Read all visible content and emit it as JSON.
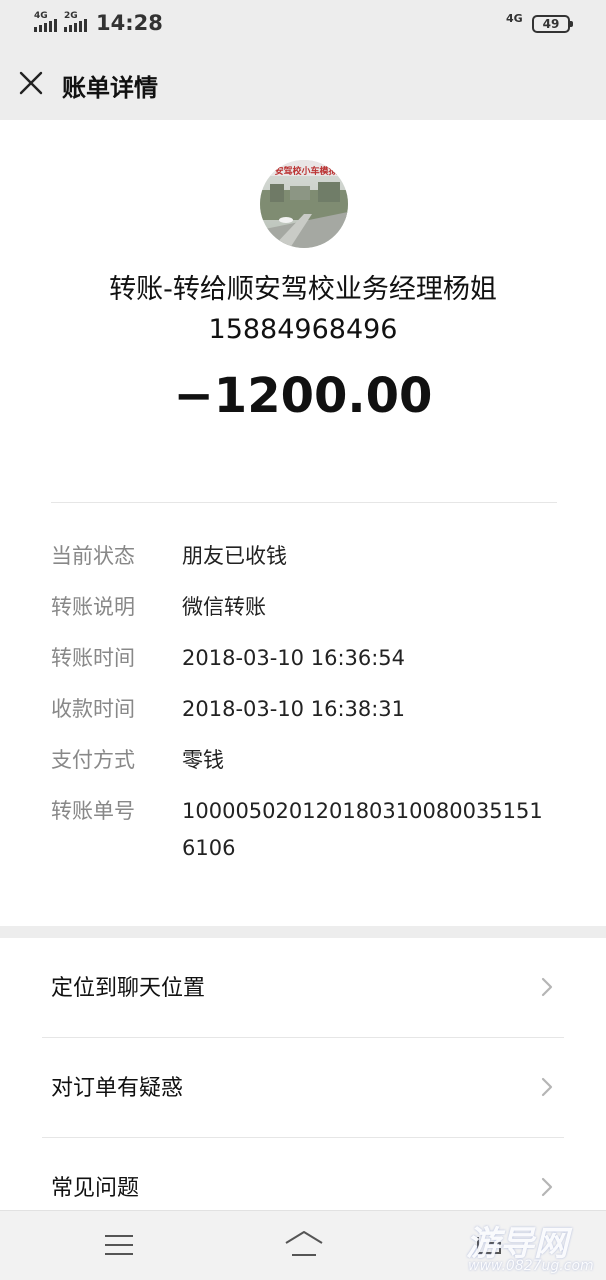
{
  "status_bar": {
    "signal1_tag": "4G",
    "signal2_tag": "2G",
    "time": "14:28",
    "network": "4G",
    "battery": "49"
  },
  "nav": {
    "close_icon": "close-icon",
    "title": "账单详情"
  },
  "transaction": {
    "avatar_caption": "安驾校小车模拟",
    "payee_line1": "转账-转给顺安驾校业务经理杨姐",
    "payee_line2": "15884968496",
    "amount": "−1200.00"
  },
  "details": [
    {
      "label": "当前状态",
      "value": "朋友已收钱"
    },
    {
      "label": "转账说明",
      "value": "微信转账"
    },
    {
      "label": "转账时间",
      "value": "2018-03-10 16:36:54"
    },
    {
      "label": "收款时间",
      "value": "2018-03-10 16:38:31"
    },
    {
      "label": "支付方式",
      "value": "零钱"
    },
    {
      "label": "转账单号",
      "value": "100005020120180310080035151 6106"
    }
  ],
  "actions": [
    {
      "label": "定位到聊天位置",
      "icon": "chevron-right-icon"
    },
    {
      "label": "对订单有疑惑",
      "icon": "chevron-right-icon"
    },
    {
      "label": "常见问题",
      "icon": "chevron-right-icon"
    }
  ],
  "system_nav": {
    "menu_icon": "menu-icon",
    "home_icon": "home-icon",
    "back_icon": "back-icon"
  },
  "watermark": {
    "main": "游导网",
    "sub": "www.0827ug.com"
  }
}
